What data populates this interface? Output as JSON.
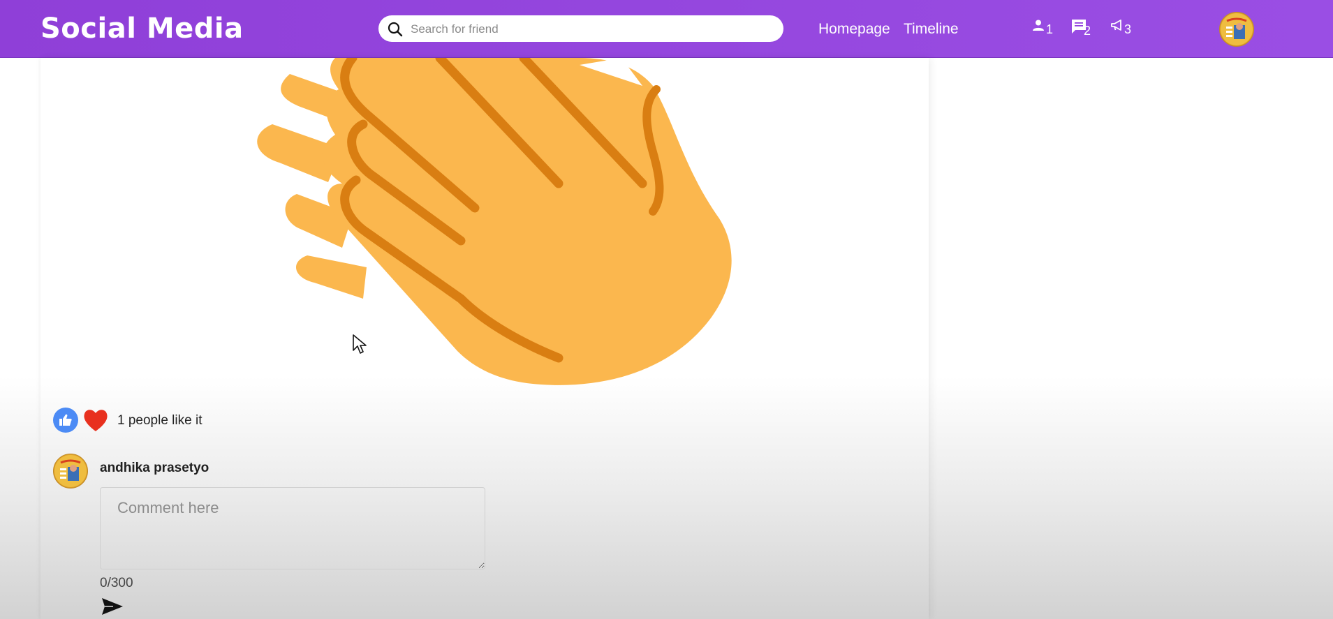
{
  "app": {
    "title": "Social Media"
  },
  "search": {
    "placeholder": "Search for friend"
  },
  "nav": {
    "homepage": "Homepage",
    "timeline": "Timeline"
  },
  "notifications": [
    {
      "icon": "person-icon",
      "count": "1"
    },
    {
      "icon": "chat-icon",
      "count": "2"
    },
    {
      "icon": "megaphone-icon",
      "count": "3"
    }
  ],
  "post": {
    "image_icon": "clapping-hands-emoji",
    "likes_text": "1 people like it",
    "reactions": [
      "thumbs-up-icon",
      "heart-icon"
    ]
  },
  "comment": {
    "user_name": "andhika prasetyo",
    "placeholder": "Comment here",
    "char_count": "0/300"
  },
  "colors": {
    "topbar": "#9244dd",
    "like": "#4c8bf5",
    "heart": "#e8301e",
    "hand": "#fbb74e",
    "hand_outline": "#d97e12"
  }
}
